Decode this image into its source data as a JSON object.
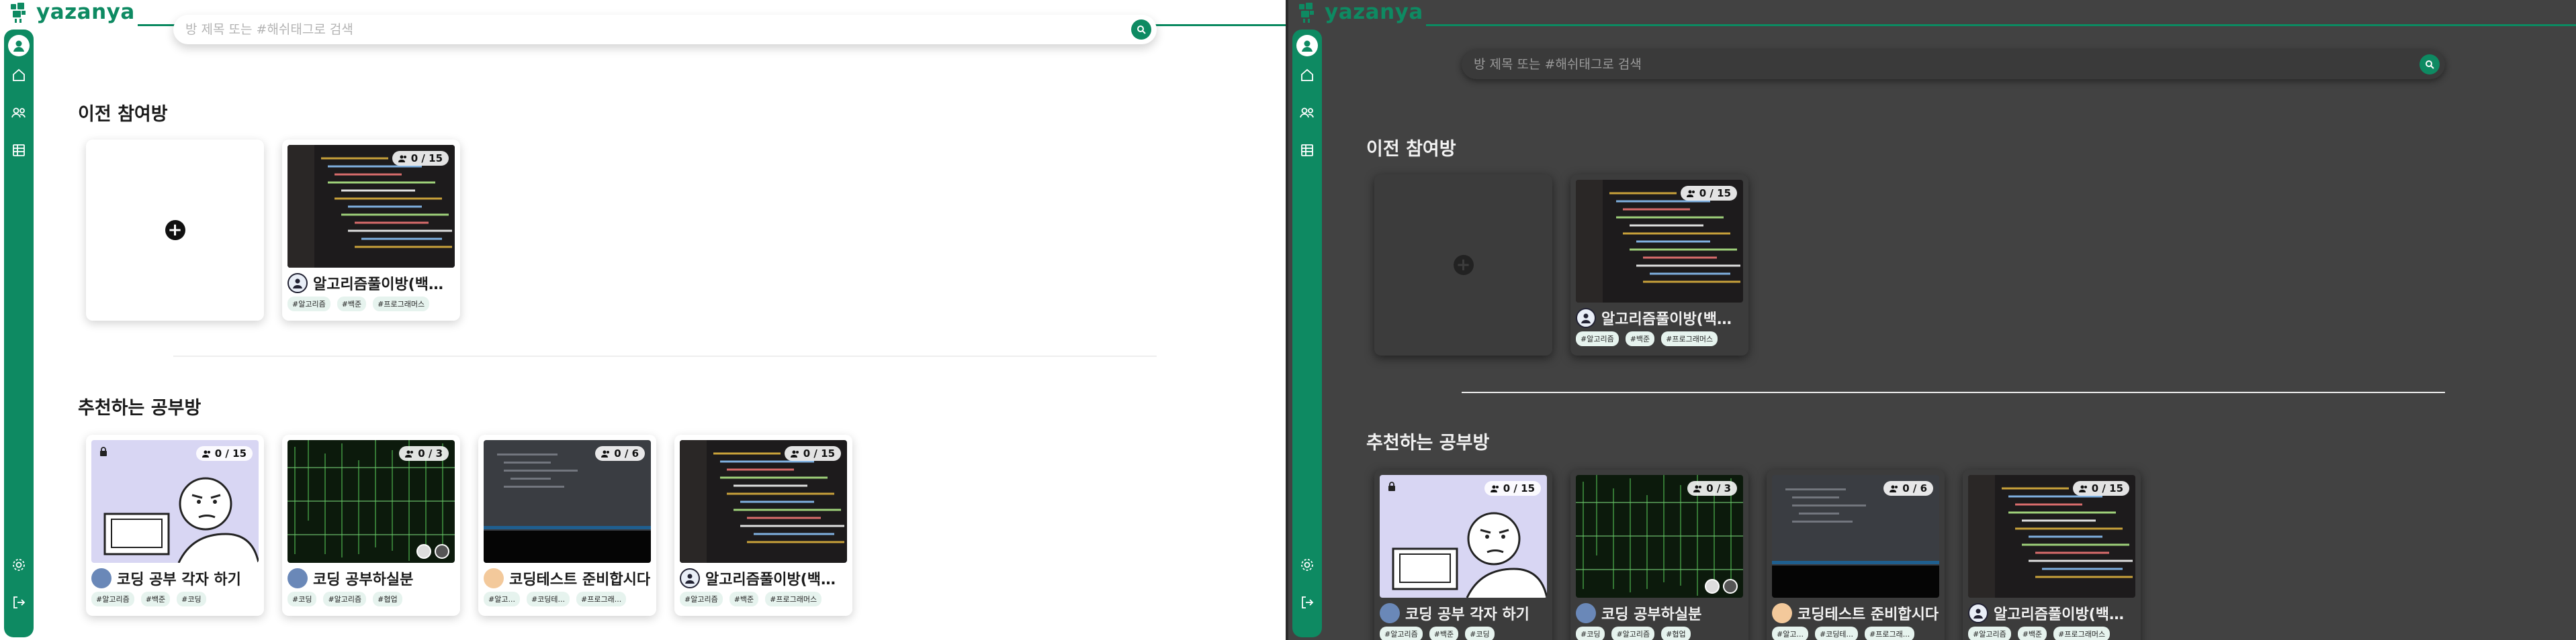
{
  "app": {
    "logo_text": "yazanya"
  },
  "search": {
    "placeholder": "방 제목 또는 #해쉬태그로 검색"
  },
  "sections": {
    "previous_title": "이전 참여방",
    "recommended_title": "추천하는 공부방"
  },
  "previous_rooms": [
    {
      "title": "알고리즘풀이방(백준,프로그래머스,etc)",
      "capacity": "0 / 15",
      "tags": [
        "#알고리즘",
        "#백준",
        "#프로그래머스"
      ]
    }
  ],
  "recommended_rooms": [
    {
      "title": "코딩 공부 각자 하기",
      "capacity": "0 / 15",
      "locked": true,
      "tags": [
        "#알고리즘",
        "#백준",
        "#코딩"
      ]
    },
    {
      "title": "코딩 공부하실분",
      "capacity": "0 / 3",
      "locked": false,
      "tags": [
        "#코딩",
        "#알고리즘",
        "#협업"
      ]
    },
    {
      "title": "코딩테스트 준비합시다",
      "capacity": "0 / 6",
      "locked": false,
      "tags": [
        "#알고...",
        "#코딩테...",
        "#프로그래..."
      ]
    },
    {
      "title": "알고리즘풀이방(백준,프로그래머스,etc)",
      "capacity": "0 / 15",
      "locked": false,
      "tags": [
        "#알고리즘",
        "#백준",
        "#프로그래머스"
      ]
    }
  ],
  "colors": {
    "brand": "#0e8a62",
    "dark_bg": "#424242",
    "light_bg": "#ffffff"
  },
  "icons": {
    "sidebar": [
      "avatar-icon",
      "home-icon",
      "friends-icon",
      "board-icon",
      "settings-icon",
      "logout-icon"
    ],
    "search": "search-icon",
    "capacity": "users-icon",
    "add": "plus-icon"
  }
}
